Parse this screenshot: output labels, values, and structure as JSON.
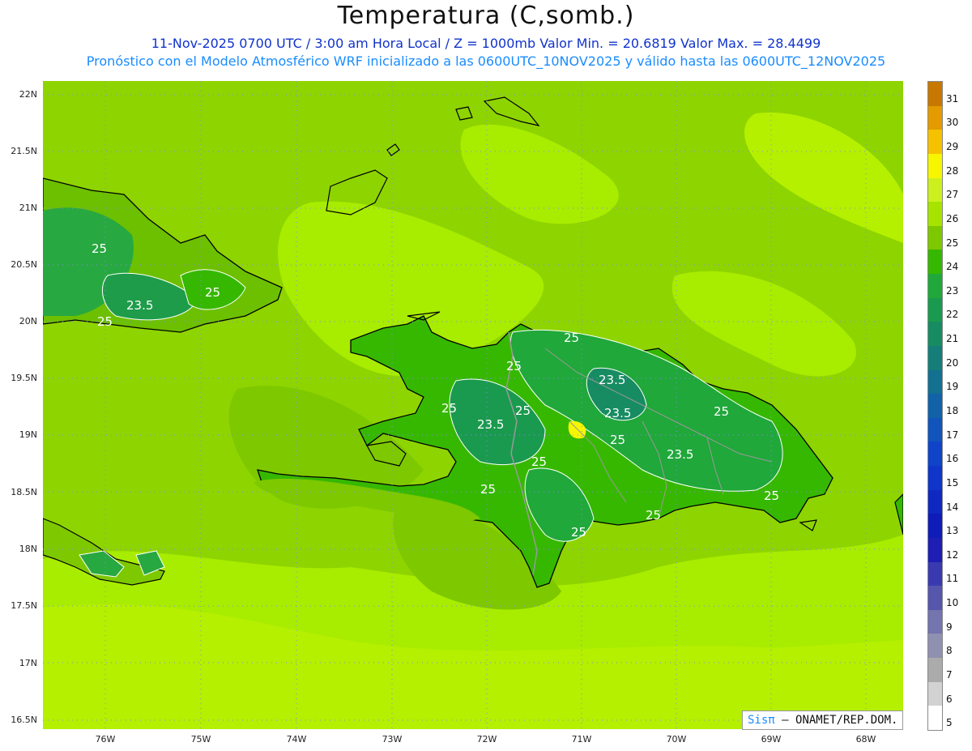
{
  "title": "Temperatura (C,somb.)",
  "subtitle_line1": "11-Nov-2025  0700 UTC / 3:00 am Hora Local / Z = 1000mb   Valor Min. = 20.6819  Valor Max. = 28.4499",
  "subtitle_line2": "Pronóstico con el Modelo Atmosférico WRF inicializado a las 0600UTC_10NOV2025 y válido hasta las  0600UTC_12NOV2025",
  "latitude_labels": [
    "22N",
    "21.5N",
    "21N",
    "20.5N",
    "20N",
    "19.5N",
    "19N",
    "18.5N",
    "18N",
    "17.5N",
    "17N",
    "16.5N"
  ],
  "longitude_labels": [
    "76W",
    "75W",
    "74W",
    "73W",
    "72W",
    "71W",
    "70W",
    "69W",
    "68W"
  ],
  "colorbar": {
    "labels": [
      "31",
      "30",
      "29",
      "28",
      "27",
      "26",
      "25",
      "24",
      "23",
      "22",
      "21",
      "20",
      "19",
      "18",
      "17",
      "16",
      "15",
      "14",
      "13",
      "12",
      "11",
      "10",
      "9",
      "8",
      "7",
      "6",
      "5"
    ],
    "colors": [
      "#c77800",
      "#e39b00",
      "#f6c200",
      "#f6f600",
      "#ccf01e",
      "#a6e400",
      "#7ec800",
      "#36b800",
      "#20a83a",
      "#1a9a4e",
      "#178c62",
      "#157e78",
      "#137090",
      "#1262a8",
      "#1054bc",
      "#0f44c8",
      "#0f36c8",
      "#0f28c0",
      "#0f1cb8",
      "#1e1eb4",
      "#3a3ab0",
      "#5656ac",
      "#7474ae",
      "#9090b0",
      "#ababab",
      "#d2d2d2",
      "#ffffff"
    ]
  },
  "contour_labels": [
    "25",
    "23.5",
    "25",
    "25",
    "25",
    "25",
    "23.5",
    "25",
    "23.5",
    "25",
    "23.5",
    "25",
    "23.5",
    "25",
    "25",
    "25",
    "25",
    "25",
    "25"
  ],
  "credit": {
    "logo": "Sisπ",
    "text": "– ONAMET/REP.DOM."
  }
}
